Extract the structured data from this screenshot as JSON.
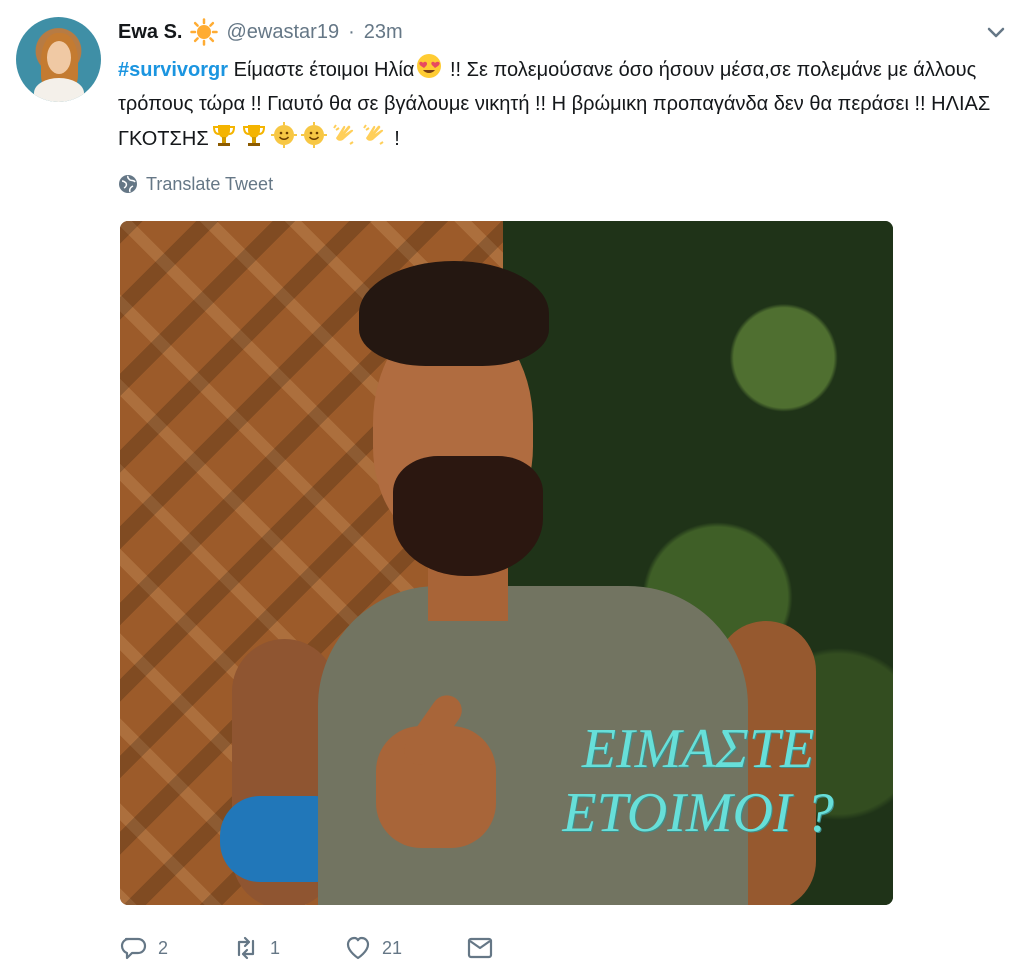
{
  "tweet": {
    "author": {
      "name": "Ewa S.",
      "handle": "@ewastar19",
      "time": "23m",
      "separator": "·",
      "status_emoji": "sun-icon"
    },
    "text": {
      "hashtag": "#survivorgr",
      "part1": "Είμαστε έτοιμοι Ηλία",
      "part2": "!! Σε πολεμούσανε όσο ήσουν μέσα,σε πολεμάνε με άλλους τρόπους τώρα !! Γιαυτό θα σε βγάλουμε νικητή !! Η βρώμικη προπαγάνδα δεν θα περάσει !! ΗΛΙΑΣ ΓΚΟΤΣΗΣ",
      "end": "!",
      "emojis": [
        "heart-eyes-icon",
        "trophy-icon",
        "trophy-icon",
        "smiling-sun-icon",
        "smiling-sun-icon",
        "clapping-hands-icon",
        "clapping-hands-icon"
      ]
    },
    "translate_label": "Translate Tweet",
    "media": {
      "overlay_line1": "ΕΙΜΑΣΤΕ",
      "overlay_line2": "ΕΤΟΙΜΟΙ ?",
      "colors": {
        "overlay": "#67dfd9",
        "armband": "#2177b9"
      }
    },
    "actions": {
      "replies": "2",
      "retweets": "1",
      "likes": "21"
    },
    "colors": {
      "primary": "#14171a",
      "secondary": "#657786",
      "link": "#1b95e0"
    }
  }
}
